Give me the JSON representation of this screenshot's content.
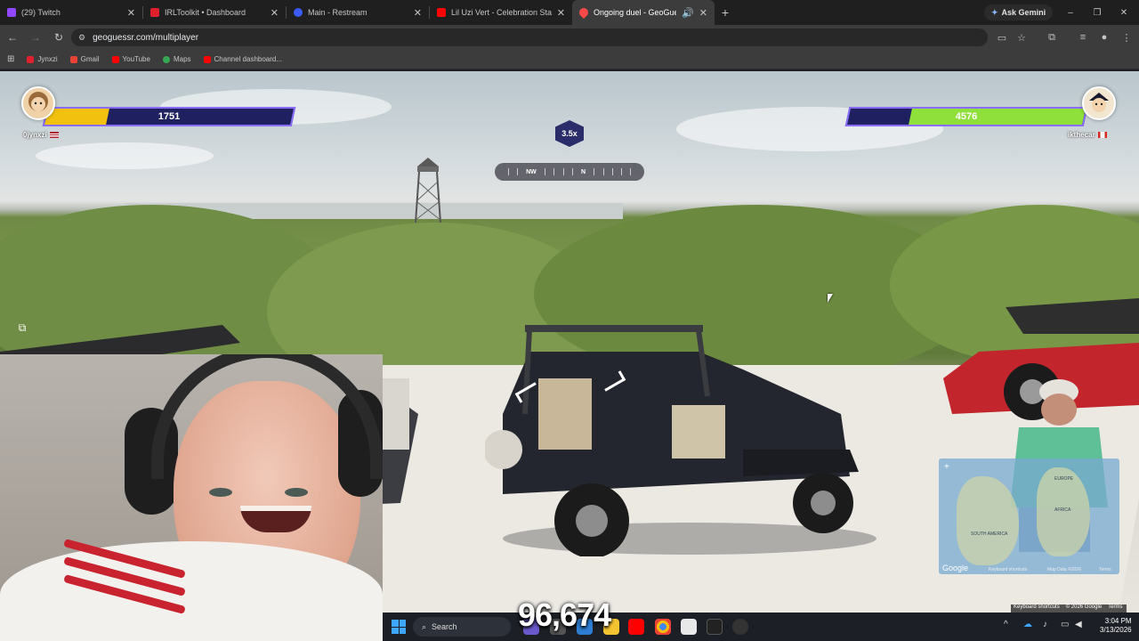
{
  "browser": {
    "tabs": [
      {
        "title": "(29) Twitch",
        "favicon_color": "#9146ff"
      },
      {
        "title": "IRLToolkit • Dashboard",
        "favicon_color": "#e0202c"
      },
      {
        "title": "Main - Restream",
        "favicon_color": "#3b5bff"
      },
      {
        "title": "Lil Uzi Vert - Celebration Station",
        "favicon_color": "#ff0000"
      },
      {
        "title": "Ongoing duel - GeoGuessr",
        "favicon_color": "#ff4848"
      }
    ],
    "new_tab": "+",
    "ask_gemini": "Ask Gemini",
    "window_controls": {
      "minimize": "–",
      "maximize": "❐",
      "close": "✕"
    },
    "url": "geoguessr.com/multiplayer",
    "bookmarks": [
      {
        "label": "Jynxzi",
        "color": "#e0202c"
      },
      {
        "label": "Gmail",
        "color": "#ea4335"
      },
      {
        "label": "YouTube",
        "color": "#ff0000"
      },
      {
        "label": "Maps",
        "color": "#34a853"
      },
      {
        "label": "Channel dashboard...",
        "color": "#ff0000"
      }
    ]
  },
  "game": {
    "player_left": {
      "name": "0jynxzi",
      "hp": "1751",
      "hp_fraction": 0.25,
      "bar_color": "#f2c10f"
    },
    "player_right": {
      "name": "ikthecar",
      "hp": "4576",
      "hp_fraction": 0.74,
      "bar_color": "#8fe03a"
    },
    "compass": {
      "left": "NW",
      "center": "N"
    },
    "multiplier": "3.5x",
    "map_labels": [
      "SOUTH AMERICA",
      "AFRICA",
      "EUROPE"
    ],
    "google_logo": "Google",
    "footer": [
      "Keyboard shortcuts",
      "© 2026 Google",
      "Terms"
    ],
    "map_footer": [
      "Keyboard shortcuts",
      "Map Data ©2026",
      "Terms"
    ]
  },
  "overlay": {
    "counter": "96,674"
  },
  "taskbar": {
    "search_label": "Search",
    "time": "3:04 PM",
    "date": "3/13/2026"
  }
}
